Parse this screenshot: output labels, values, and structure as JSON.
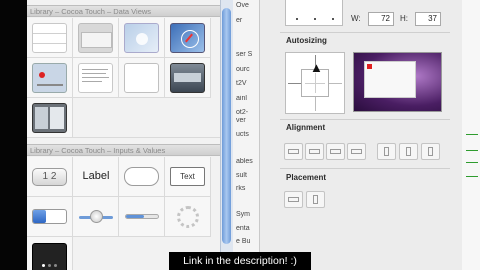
{
  "library": {
    "section1_title": "Library – Cocoa Touch – Data Views",
    "section2_title": "Library – Cocoa Touch – Inputs & Values",
    "segmented_label": "1 2",
    "label_item_text": "Label",
    "textfield_item_text": "Text"
  },
  "middle_list": [
    "Ove",
    "er",
    "ser S",
    "ourc",
    "t2V",
    "ainl",
    "ot2-",
    "ver",
    "ucts",
    "",
    "ables",
    "sult",
    "rks",
    "",
    "Sym",
    "enta",
    "e Bu"
  ],
  "inspector": {
    "w_label": "W:",
    "w_value": "72",
    "h_label": "H:",
    "h_value": "37",
    "autosizing_title": "Autosizing",
    "alignment_title": "Alignment",
    "placement_title": "Placement"
  },
  "caption": "Link in the description! :)",
  "colors": {
    "accent": "#6e9bd8",
    "preview_window": "#6a2a7a",
    "preview_marker": "#e02020"
  }
}
